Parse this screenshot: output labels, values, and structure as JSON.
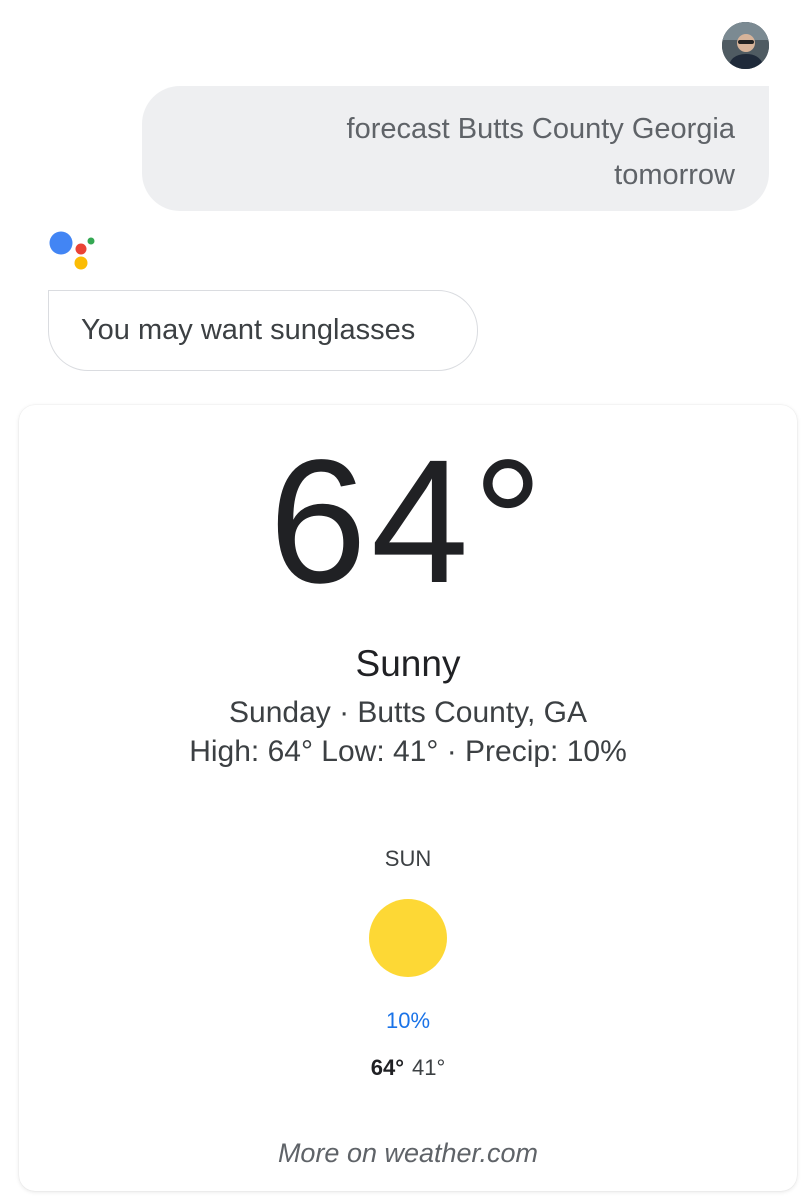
{
  "user": {
    "avatar_icon": "user-avatar",
    "query_line1": "forecast Butts County Georgia",
    "query_line2": "tomorrow"
  },
  "assistant": {
    "logo_icon": "google-assistant-logo",
    "reply": "You may want sunglasses"
  },
  "weather": {
    "temperature": "64°",
    "condition": "Sunny",
    "day_location": "Sunday · Butts County, GA",
    "details": "High: 64° Low: 41° · Precip: 10%",
    "forecast": {
      "day": "SUN",
      "icon": "sun-icon",
      "precip": "10%",
      "high": "64°",
      "low": "41°"
    },
    "source_link": "More on weather.com"
  },
  "colors": {
    "assistant_blue": "#4285F4",
    "assistant_red": "#EA4335",
    "assistant_yellow": "#FBBC05",
    "assistant_green": "#34A853",
    "sun_yellow": "#FDD835",
    "precip_blue": "#1a73e8"
  }
}
